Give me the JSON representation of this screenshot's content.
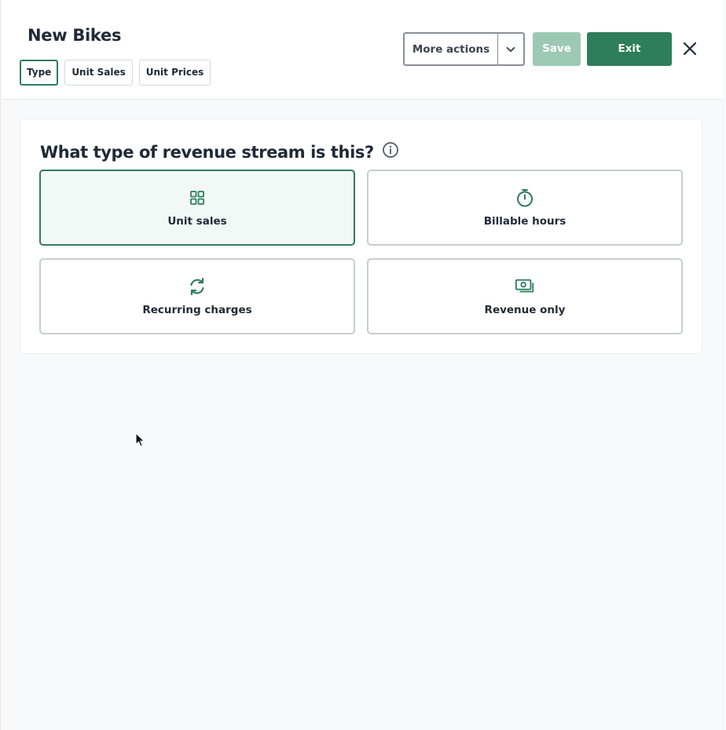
{
  "header": {
    "title": "New Bikes",
    "tabs": [
      {
        "label": "Type",
        "active": true
      },
      {
        "label": "Unit Sales",
        "active": false
      },
      {
        "label": "Unit Prices",
        "active": false
      }
    ],
    "more_actions_label": "More actions",
    "save_label": "Save",
    "exit_label": "Exit",
    "close_icon": "close-icon"
  },
  "main": {
    "question": "What type of revenue stream is this?",
    "info_icon": "info-icon",
    "options": [
      {
        "label": "Unit sales",
        "icon": "grid-icon",
        "selected": true
      },
      {
        "label": "Billable hours",
        "icon": "stopwatch-icon",
        "selected": false
      },
      {
        "label": "Recurring charges",
        "icon": "refresh-icon",
        "selected": false
      },
      {
        "label": "Revenue only",
        "icon": "cash-icon",
        "selected": false
      }
    ]
  },
  "colors": {
    "accent": "#2e7d5b",
    "accent_disabled": "#9dc9b4",
    "selected_bg": "#f1f8f5",
    "page_bg": "#f8f9fa"
  }
}
